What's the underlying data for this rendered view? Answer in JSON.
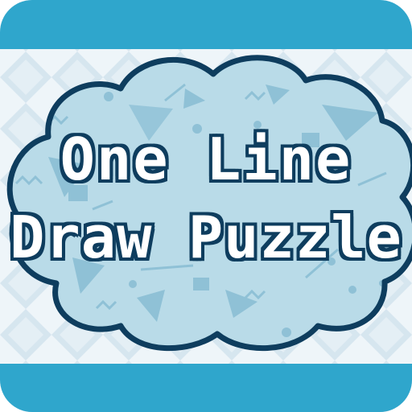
{
  "title": {
    "line1": "One Line",
    "line2": "Draw Puzzle"
  },
  "colors": {
    "band": "#2fa6cc",
    "background": "#e9f1f6",
    "cloud_fill": "#b9dbe8",
    "cloud_outline": "#0e3d5e",
    "text_fill": "#ffffff",
    "text_outline": "#0e3d5e"
  },
  "icons": [
    "triangle-shape",
    "circle-dot",
    "zigzag-line",
    "stripe-rect"
  ]
}
